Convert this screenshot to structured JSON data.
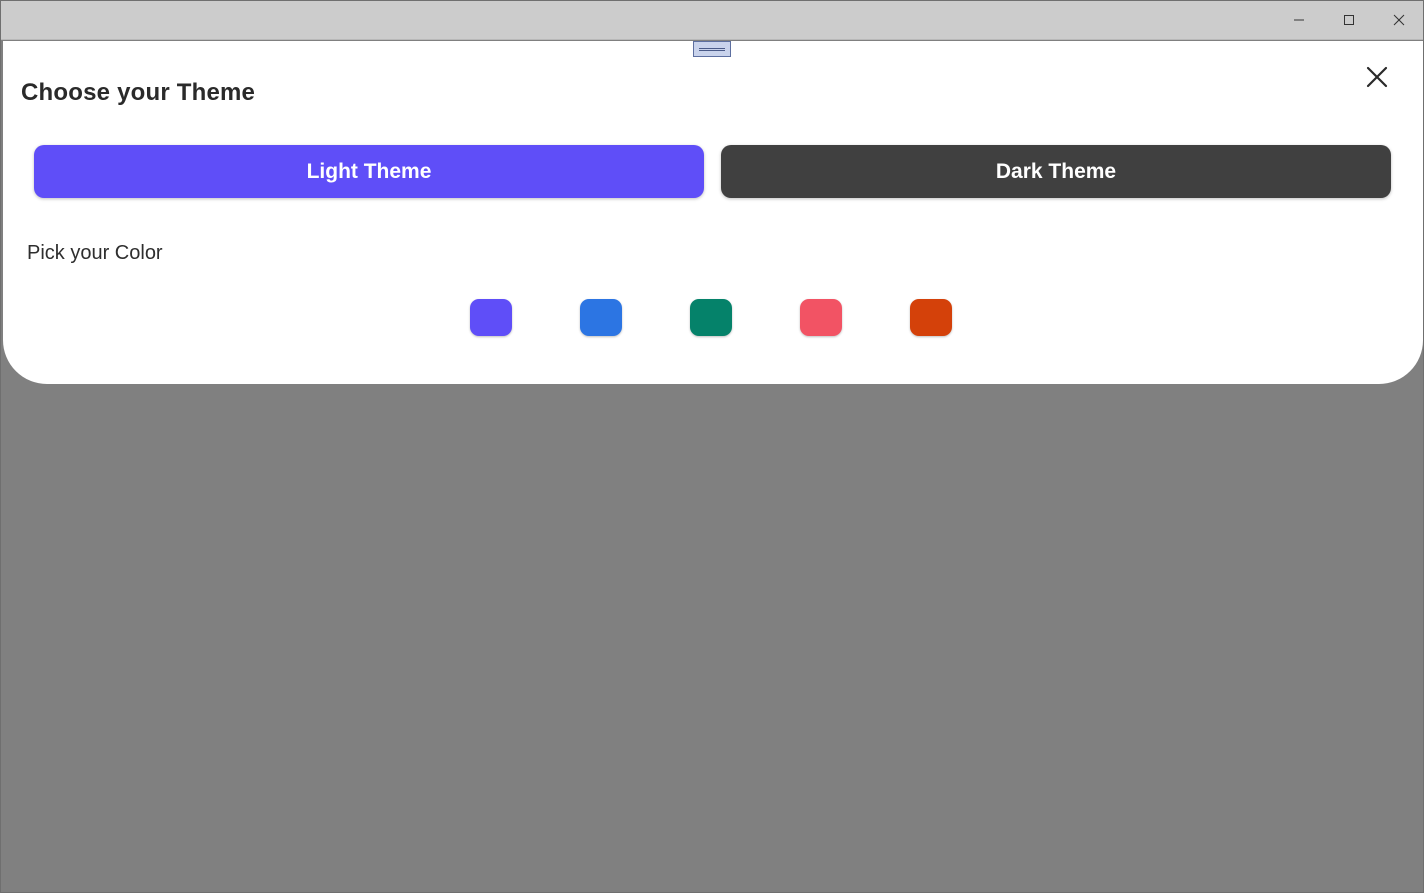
{
  "window": {
    "controls": [
      "minimize-icon",
      "maximize-icon",
      "close-icon"
    ]
  },
  "sheet": {
    "title": "Choose your Theme",
    "close_icon": "close-icon",
    "theme_buttons": {
      "light_label": "Light Theme",
      "dark_label": "Dark Theme",
      "light_color": "#5f4ef8",
      "dark_color": "#404040"
    },
    "color_section": {
      "label": "Pick your Color",
      "swatches": [
        "#5f4ef8",
        "#2c75e3",
        "#05826a",
        "#f25364",
        "#d4410a"
      ]
    }
  },
  "backdrop_color": "#808080"
}
